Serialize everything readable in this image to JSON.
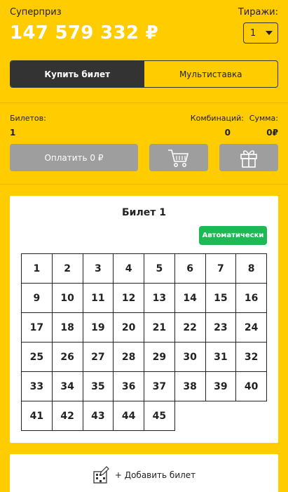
{
  "header": {
    "superprize_label": "Суперприз",
    "superprize_value": "147 579 332 ₽",
    "draws_label": "Тиражи:",
    "draws_selected": "1"
  },
  "tabs": [
    {
      "label": "Купить билет",
      "active": true
    },
    {
      "label": "Мультиставка",
      "active": false
    }
  ],
  "stats": {
    "tickets_label": "Билетов:",
    "tickets_value": "1",
    "combinations_label": "Комбинаций:",
    "combinations_value": "0",
    "sum_label": "Сумма:",
    "sum_value": "0₽"
  },
  "actions": {
    "pay_label": "Оплатить 0 ₽",
    "cart_icon": "cart-icon",
    "gift_icon": "gift-icon"
  },
  "ticket": {
    "title": "Билет 1",
    "auto_label": "Автоматически",
    "numbers": [
      1,
      2,
      3,
      4,
      5,
      6,
      7,
      8,
      9,
      10,
      11,
      12,
      13,
      14,
      15,
      16,
      17,
      18,
      19,
      20,
      21,
      22,
      23,
      24,
      25,
      26,
      27,
      28,
      29,
      30,
      31,
      32,
      33,
      34,
      35,
      36,
      37,
      38,
      39,
      40,
      41,
      42,
      43,
      44,
      45
    ],
    "columns": 8
  },
  "add_ticket": {
    "label": "+ Добавить билет",
    "icon": "add-ticket-icon"
  },
  "colors": {
    "background": "#FFCC00",
    "dark": "#333333",
    "disabled": "#9e9e9e",
    "green": "#1db954"
  }
}
